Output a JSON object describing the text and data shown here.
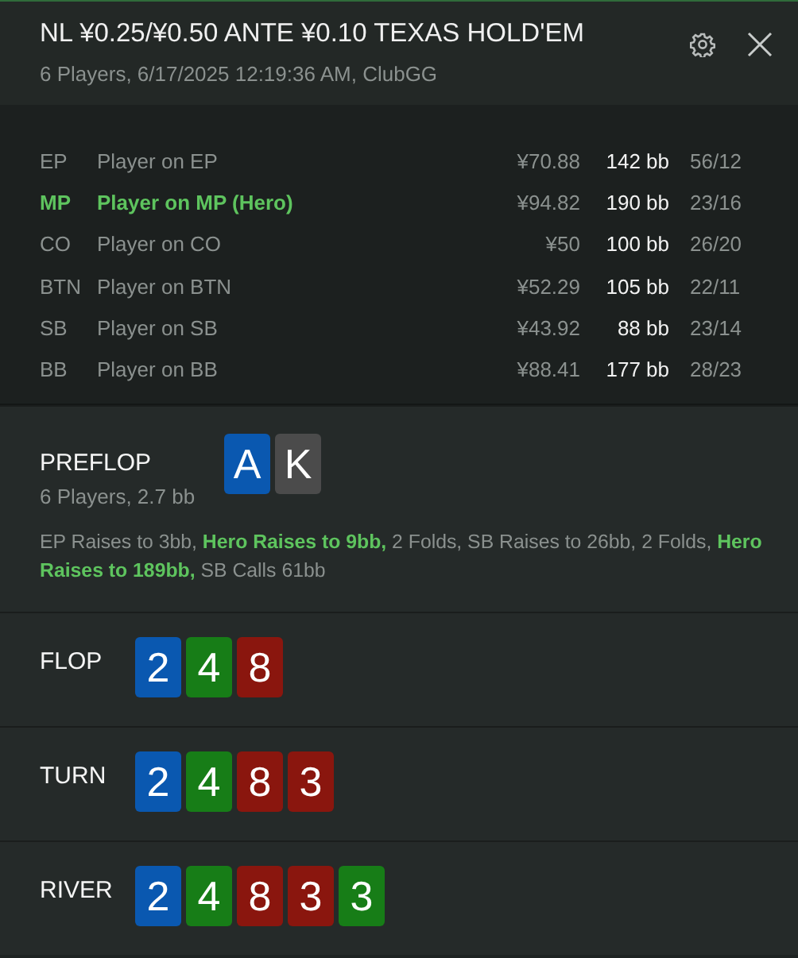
{
  "header": {
    "title": "NL ¥0.25/¥0.50 ANTE ¥0.10 TEXAS HOLD'EM",
    "subtitle": "6 Players, 6/17/2025 12:19:36 AM, ClubGG"
  },
  "players": [
    {
      "position": "EP",
      "name": "Player on EP",
      "stack": "¥70.88",
      "bb": "142 bb",
      "stats": "56/12",
      "hero": false
    },
    {
      "position": "MP",
      "name": "Player on MP (Hero)",
      "stack": "¥94.82",
      "bb": "190 bb",
      "stats": "23/16",
      "hero": true
    },
    {
      "position": "CO",
      "name": "Player on CO",
      "stack": "¥50",
      "bb": "100 bb",
      "stats": "26/20",
      "hero": false
    },
    {
      "position": "BTN",
      "name": "Player on BTN",
      "stack": "¥52.29",
      "bb": "105 bb",
      "stats": "22/11",
      "hero": false
    },
    {
      "position": "SB",
      "name": "Player on SB",
      "stack": "¥43.92",
      "bb": "88 bb",
      "stats": "23/14",
      "hero": false
    },
    {
      "position": "BB",
      "name": "Player on BB",
      "stack": "¥88.41",
      "bb": "177 bb",
      "stats": "28/23",
      "hero": false
    }
  ],
  "streets": [
    {
      "name": "PREFLOP",
      "summary": "6 Players, 2.7 bb",
      "cards": [
        {
          "rank": "A",
          "color": "#0a58b0"
        },
        {
          "rank": "K",
          "color": "#4b4b4b"
        }
      ],
      "actions": "EP Raises to 3bb, **Hero Raises to 9bb,** 2 Folds, SB Raises to 26bb, 2 Folds, **Hero Raises to 189bb,** SB Calls 61bb"
    },
    {
      "name": "FLOP",
      "cards": [
        {
          "rank": "2",
          "color": "#0a58b0"
        },
        {
          "rank": "4",
          "color": "#177d17"
        },
        {
          "rank": "8",
          "color": "#8a160e"
        }
      ]
    },
    {
      "name": "TURN",
      "cards": [
        {
          "rank": "2",
          "color": "#0a58b0"
        },
        {
          "rank": "4",
          "color": "#177d17"
        },
        {
          "rank": "8",
          "color": "#8a160e"
        },
        {
          "rank": "3",
          "color": "#8a160e"
        }
      ]
    },
    {
      "name": "RIVER",
      "cards": [
        {
          "rank": "2",
          "color": "#0a58b0"
        },
        {
          "rank": "4",
          "color": "#177d17"
        },
        {
          "rank": "8",
          "color": "#8a160e"
        },
        {
          "rank": "3",
          "color": "#8a160e"
        },
        {
          "rank": "3",
          "color": "#177d17"
        }
      ]
    }
  ]
}
